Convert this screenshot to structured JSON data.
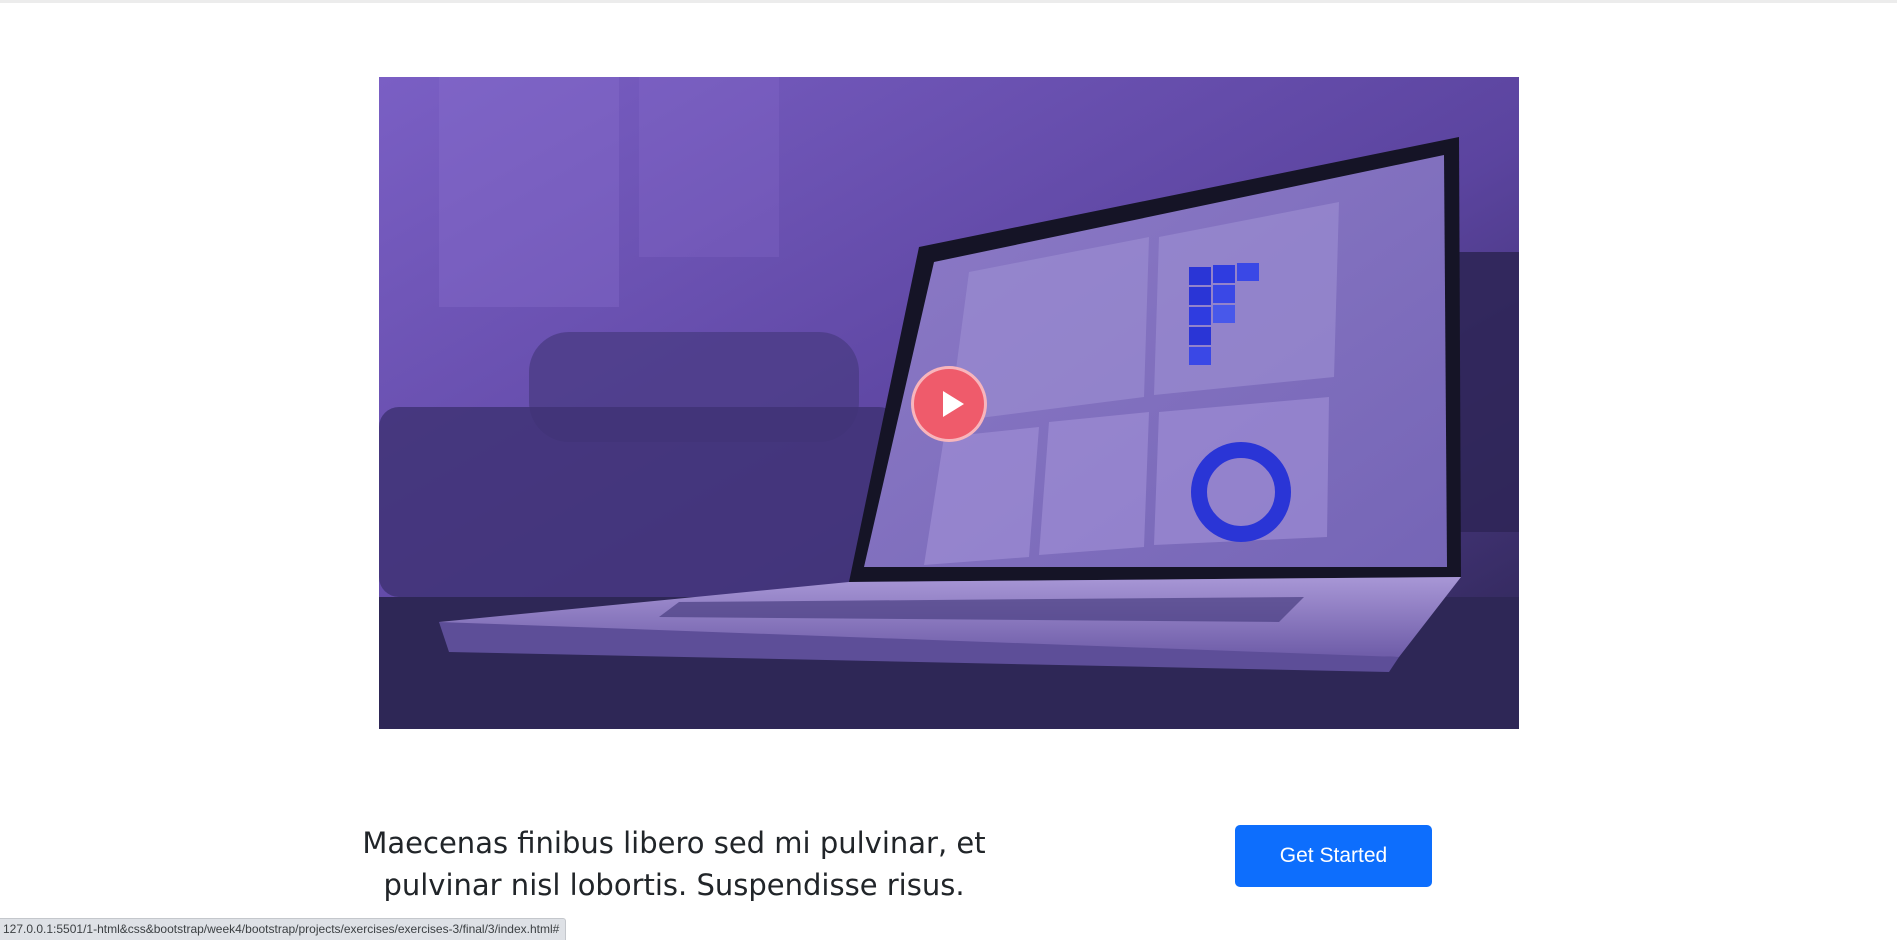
{
  "hero": {
    "video_thumbnail": "laptop-analytics-dashboard",
    "overlay_color": "#6a4cbf",
    "play_icon": "play-icon",
    "play_color": "#ef5b6b"
  },
  "cta": {
    "tagline": "Maecenas finibus libero sed mi pulvinar, et pulvinar nisl lobortis. Suspendisse risus.",
    "button_label": "Get Started",
    "button_color": "#0d6efd"
  },
  "browser": {
    "status_url": "127.0.0.1:5501/1-html&css&bootstrap/week4/bootstrap/projects/exercises/exercises-3/final/3/index.html#"
  }
}
